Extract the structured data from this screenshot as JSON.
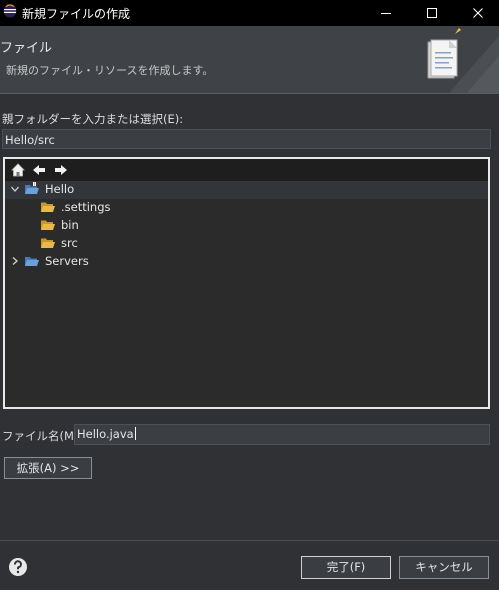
{
  "window": {
    "title": "新規ファイルの作成"
  },
  "banner": {
    "title": "ファイル",
    "description": "新規のファイル・リソースを作成します。"
  },
  "parent_folder": {
    "label": "親フォルダーを入力または選択(E):",
    "value": "Hello/src"
  },
  "tree": {
    "items": [
      {
        "label": "Hello",
        "depth": 0,
        "expanded": true,
        "type": "project"
      },
      {
        "label": ".settings",
        "depth": 1,
        "type": "folder"
      },
      {
        "label": "bin",
        "depth": 1,
        "type": "folder"
      },
      {
        "label": "src",
        "depth": 1,
        "type": "folder"
      },
      {
        "label": "Servers",
        "depth": 0,
        "expanded": false,
        "type": "project"
      }
    ]
  },
  "file_name": {
    "label": "ファイル名(M):",
    "value": "Hello.java"
  },
  "buttons": {
    "advanced": "拡張(A) >>",
    "finish": "完了(F)",
    "cancel": "キャンセル"
  },
  "colors": {
    "background": "#2f3135",
    "titlebar": "#000000",
    "folder": "#e8b84a",
    "tree_background": "#2b2b2b"
  },
  "icons": {
    "app": "eclipse-icon",
    "home": "home-icon",
    "back": "back-arrow-icon",
    "forward": "forward-arrow-icon",
    "help": "help-icon",
    "wizard": "new-file-wizard-image"
  }
}
